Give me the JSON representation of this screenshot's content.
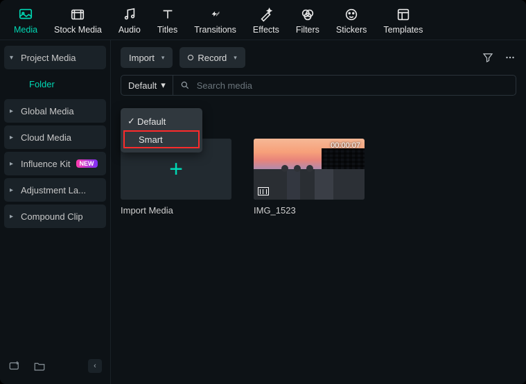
{
  "tabs": {
    "media": "Media",
    "stock_media": "Stock Media",
    "audio": "Audio",
    "titles": "Titles",
    "transitions": "Transitions",
    "effects": "Effects",
    "filters": "Filters",
    "stickers": "Stickers",
    "templates": "Templates"
  },
  "sidebar": {
    "project_media": "Project Media",
    "folder": "Folder",
    "global_media": "Global Media",
    "cloud_media": "Cloud Media",
    "influence_kit": "Influence Kit",
    "influence_badge": "NEW",
    "adjustment_layer": "Adjustment La...",
    "compound_clip": "Compound Clip"
  },
  "toolbar": {
    "import": "Import",
    "record": "Record"
  },
  "sort": {
    "trigger": "Default",
    "option_default": "Default",
    "option_smart": "Smart"
  },
  "search": {
    "placeholder": "Search media"
  },
  "grid": {
    "import_label": "Import Media",
    "clip1_name": "IMG_1523",
    "clip1_duration": "00:00:07"
  }
}
